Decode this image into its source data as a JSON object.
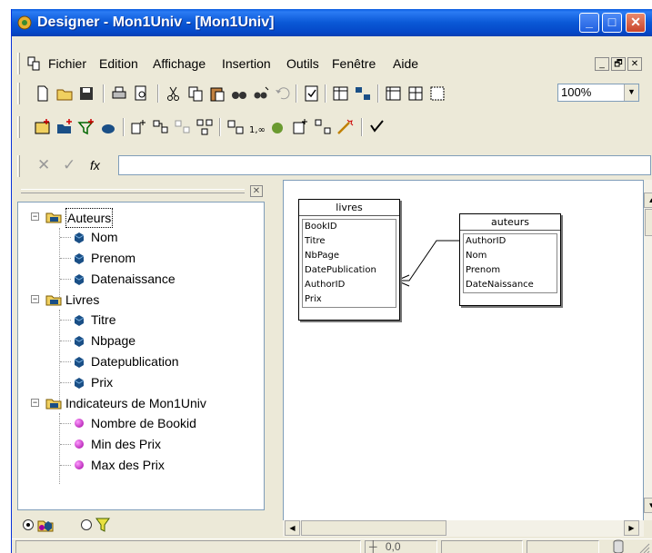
{
  "window": {
    "title": "Designer - Mon1Univ - [Mon1Univ]",
    "buttons": {
      "minimize": "_",
      "maximize": "□",
      "close": "✕"
    }
  },
  "menubar": {
    "items": [
      "Fichier",
      "Edition",
      "Affichage",
      "Insertion",
      "Outils",
      "Fenêtre",
      "Aide"
    ],
    "mdi_buttons": [
      "_",
      "🗗",
      "✕"
    ]
  },
  "toolbar": {
    "zoom_value": "100%",
    "zoom_arrow": "▼"
  },
  "formula_bar": {
    "cancel_symbol": "✕",
    "accept_symbol": "✓",
    "function_symbol": "fx",
    "value": ""
  },
  "tree": {
    "classes": [
      {
        "label": "Auteurs",
        "objects": [
          "Nom",
          "Prenom",
          "Datenaissance"
        ]
      },
      {
        "label": "Livres",
        "objects": [
          "Titre",
          "Nbpage",
          "Datepublication",
          "Prix"
        ]
      },
      {
        "label": "Indicateurs de Mon1Univ",
        "indicators": [
          "Nombre de Bookid",
          "Min des Prix",
          "Max des Prix"
        ]
      }
    ],
    "expander_symbol": "−",
    "close_symbol": "✕"
  },
  "diagram": {
    "tables": [
      {
        "name": "livres",
        "fields": [
          "BookID",
          "Titre",
          "NbPage",
          "DatePublication",
          "AuthorID",
          "Prix"
        ]
      },
      {
        "name": "auteurs",
        "fields": [
          "AuthorID",
          "Nom",
          "Prenom",
          "DateNaissance"
        ]
      }
    ]
  },
  "scrollbars": {
    "up": "▲",
    "down": "▼",
    "left": "◀",
    "right": "▶"
  },
  "statusbar": {
    "coordinates": "0,0",
    "coord_icon_symbol": "┼"
  },
  "colors": {
    "titlebar": "#0a58d6",
    "window_bg": "#ece9d8",
    "indicator": "#a000a0",
    "field_icon": "#1a4f86"
  }
}
